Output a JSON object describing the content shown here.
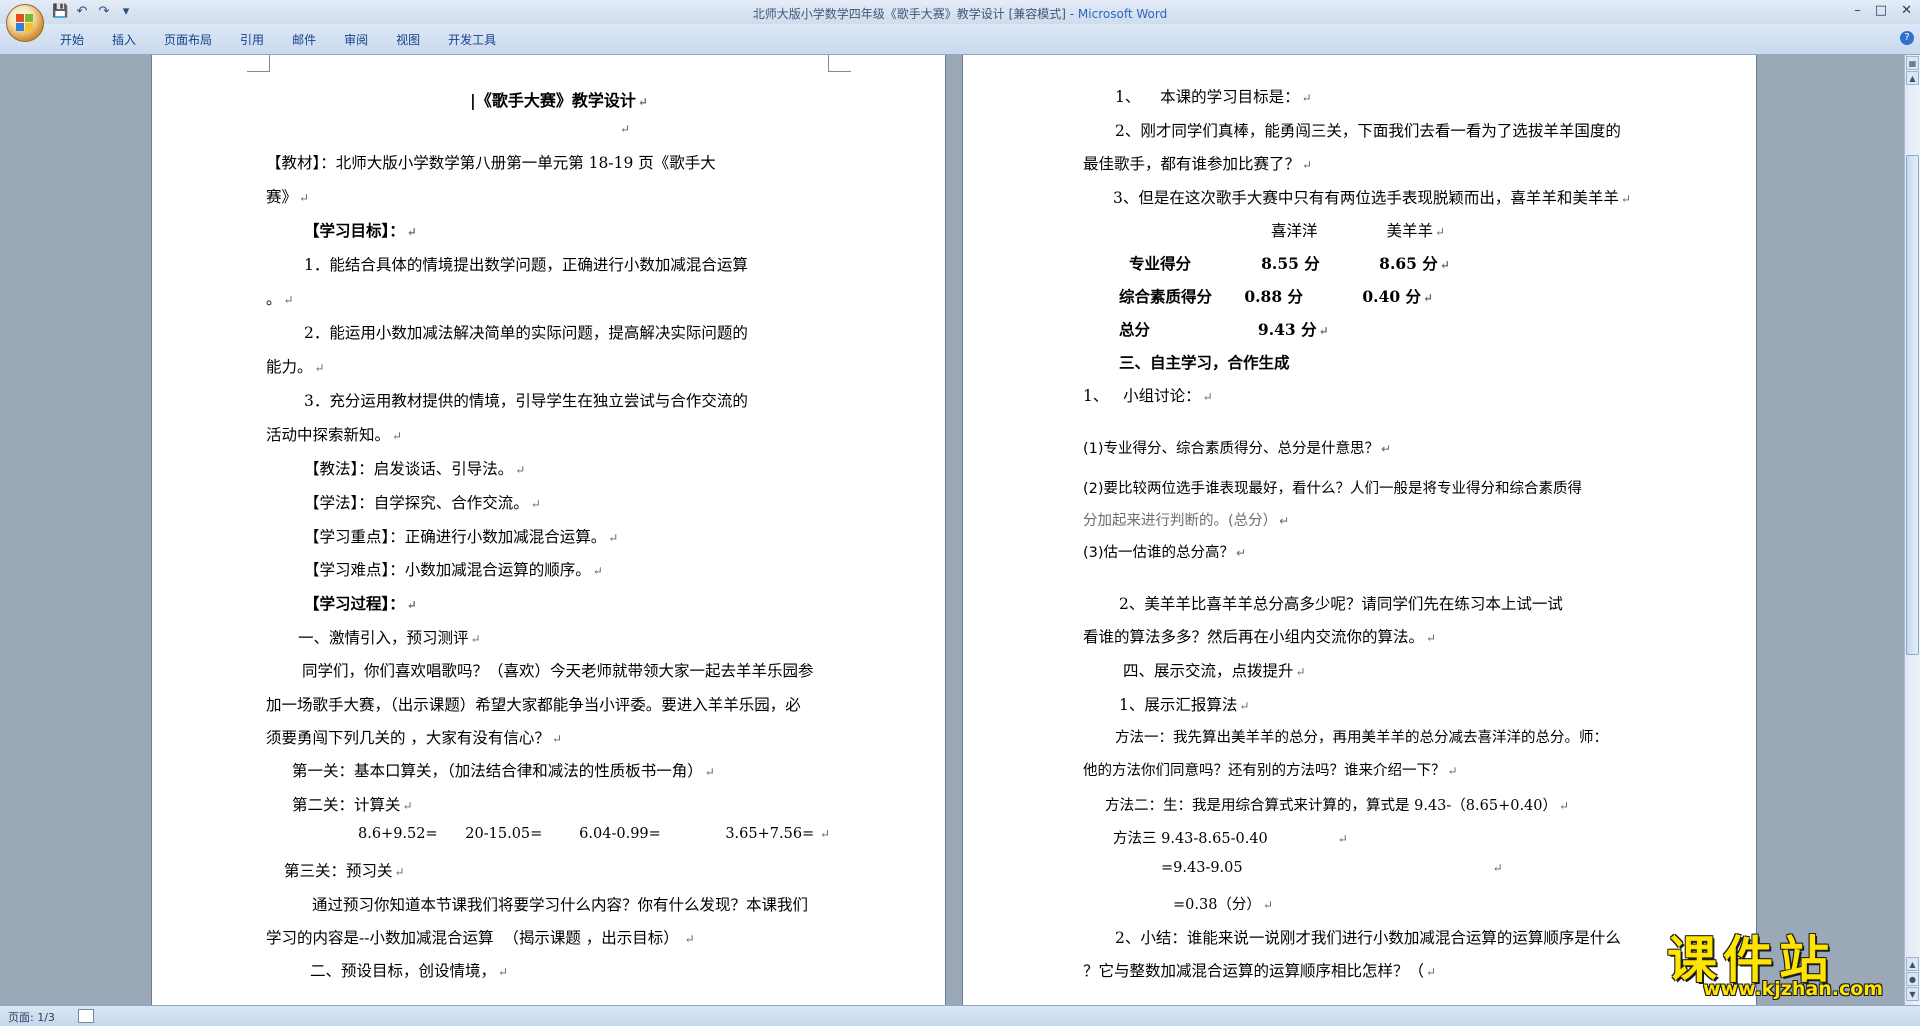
{
  "window": {
    "title": "北师大版小学数学四年级《歌手大赛》教学设计 [兼容模式] - ",
    "app_name": "Microsoft Word"
  },
  "ribbon": {
    "tabs": [
      "开始",
      "插入",
      "页面布局",
      "引用",
      "邮件",
      "审阅",
      "视图",
      "开发工具"
    ]
  },
  "page1": {
    "lines": [
      {
        "text": "|《歌手大赛》教学设计",
        "bold": true
      },
      {
        "text": ""
      },
      {
        "text": "【教材】：北师大版小学数学第八册第一单元第 18-19 页《歌手大",
        "bold_prefix": "【教材】"
      },
      {
        "text": "赛》"
      },
      {
        "text": "【学习目标】：",
        "bold": true
      },
      {
        "text": "1．能结合具体的情境提出数学问题，正确进行小数加减混合运算"
      },
      {
        "text": "。"
      },
      {
        "text": "2．能运用小数加减法解决简单的实际问题，提高解决实际问题的"
      },
      {
        "text": "能力。"
      },
      {
        "text": "3．充分运用教材提供的情境，引导学生在独立尝试与合作交流的"
      },
      {
        "text": "活动中探索新知。"
      },
      {
        "text": "【教法】：启发谈话、引导法。"
      },
      {
        "text": "【学法】：自学探究、合作交流。"
      },
      {
        "text": "【学习重点】：正确进行小数加减混合运算。"
      },
      {
        "text": "【学习难点】：小数加减混合运算的顺序。"
      },
      {
        "text": "【学习过程】：",
        "bold": true
      },
      {
        "text": "一、激情引入，预习测评"
      },
      {
        "text": "同学们，你们喜欢唱歌吗？（喜欢）今天老师就带领大家一起去羊羊乐园参"
      },
      {
        "text": "加一场歌手大赛，（出示课题）希望大家都能争当小评委。要进入羊羊乐园，必"
      },
      {
        "text": "须要勇闯下列几关的 ，大家有没有信心？"
      },
      {
        "text": "第一关：基本口算关，（加法结合律和减法的性质板书一角）"
      },
      {
        "text": "第二关：计算关"
      },
      {
        "text": "8.6+9.52=      20-15.05=        6.04-0.99=              3.65+7.56="
      },
      {
        "text": "第三关：预习关"
      },
      {
        "text": "通过预习你知道本节课我们将要学习什么内容？你有什么发现？本课我们"
      },
      {
        "text": "学习的内容是--小数加减混合运算  （揭示课题 ，出示目标）"
      },
      {
        "text": "二、预设目标，创设情境，"
      }
    ]
  },
  "page2": {
    "lines": [
      {
        "text": "1、    本课的学习目标是："
      },
      {
        "text": "2、刚才同学们真棒，能勇闯三关，下面我们去看一看为了选拔羊羊国度的"
      },
      {
        "text": "最佳歌手，都有谁参加比赛了？"
      },
      {
        "text": "3、但是在这次歌手大赛中只有有两位选手表现脱颖而出，喜羊羊和美羊羊"
      },
      {
        "text": "喜洋洋              美羊羊"
      },
      {
        "text": "专业得分             8.55 分           8.65 分",
        "bold": true
      },
      {
        "text": "综合素质得分      0.88 分           0.40 分",
        "bold": true
      },
      {
        "text": "总分                    9.43 分",
        "bold": true
      },
      {
        "text": "三、自主学习，合作生成",
        "bold": true
      },
      {
        "text": "1、   小组讨论："
      },
      {
        "text": "(1)专业得分、综合素质得分、总分是什意思？"
      },
      {
        "text": "(2)要比较两位选手谁表现最好，看什么？人们一般是将专业得分和综合素质得"
      },
      {
        "text": "分加起来进行判断的。(总分）"
      },
      {
        "text": "(3)估一估谁的总分高？"
      },
      {
        "text": "2、美羊羊比喜羊羊总分高多少呢？请同学们先在练习本上试一试"
      },
      {
        "text": "看谁的算法多多？然后再在小组内交流你的算法。"
      },
      {
        "text": "四、展示交流，点拨提升"
      },
      {
        "text": "1、展示汇报算法"
      },
      {
        "text": "方法一：我先算出美羊羊的总分，再用美羊羊的总分减去喜洋洋的总分。师："
      },
      {
        "text": "他的方法你们同意吗？还有别的方法吗？谁来介绍一下？"
      },
      {
        "text": "方法二：生：我是用综合算式来计算的，算式是 9.43-（8.65+0.40）"
      },
      {
        "text": "方法三 9.43-8.65-0.40"
      },
      {
        "text": "=9.43-9.05"
      },
      {
        "text": "=0.38（分）"
      },
      {
        "text": "2、小结：谁能来说一说刚才我们进行小数加减混合运算的运算顺序是什么"
      },
      {
        "text": "？它与整数加减混合运算的运算顺序相比怎样？（"
      }
    ]
  },
  "statusbar": {
    "page_info": "页面: 1/3"
  },
  "watermark": {
    "main": "课件站",
    "url": "www.kjzhan.com"
  }
}
